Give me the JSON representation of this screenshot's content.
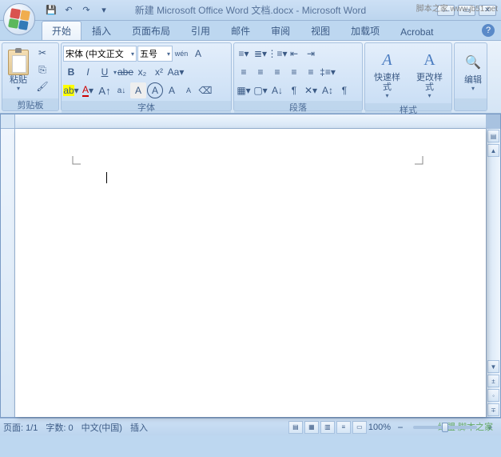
{
  "title": "新建 Microsoft Office Word 文档.docx - Microsoft Word",
  "watermark_top": "脚本之家\nwww.jb51.net",
  "qat": {
    "save": "💾",
    "undo": "↶",
    "redo": "↷"
  },
  "tabs": [
    "开始",
    "插入",
    "页面布局",
    "引用",
    "邮件",
    "审阅",
    "视图",
    "加载项",
    "Acrobat"
  ],
  "active_tab": 0,
  "groups": {
    "clipboard": {
      "label": "剪贴板",
      "paste": "粘贴"
    },
    "font": {
      "label": "字体",
      "name": "宋体 (中文正文",
      "size": "五号"
    },
    "paragraph": {
      "label": "段落"
    },
    "styles": {
      "label": "样式",
      "quick": "快速样式",
      "change": "更改样式"
    },
    "editing": {
      "label": "编辑"
    }
  },
  "status": {
    "page": "页面: 1/1",
    "words": "字数: 0",
    "lang": "中文(中国)",
    "mode": "插入",
    "zoom": "100%"
  },
  "watermark_bottom": "绿盟 脚本之家"
}
